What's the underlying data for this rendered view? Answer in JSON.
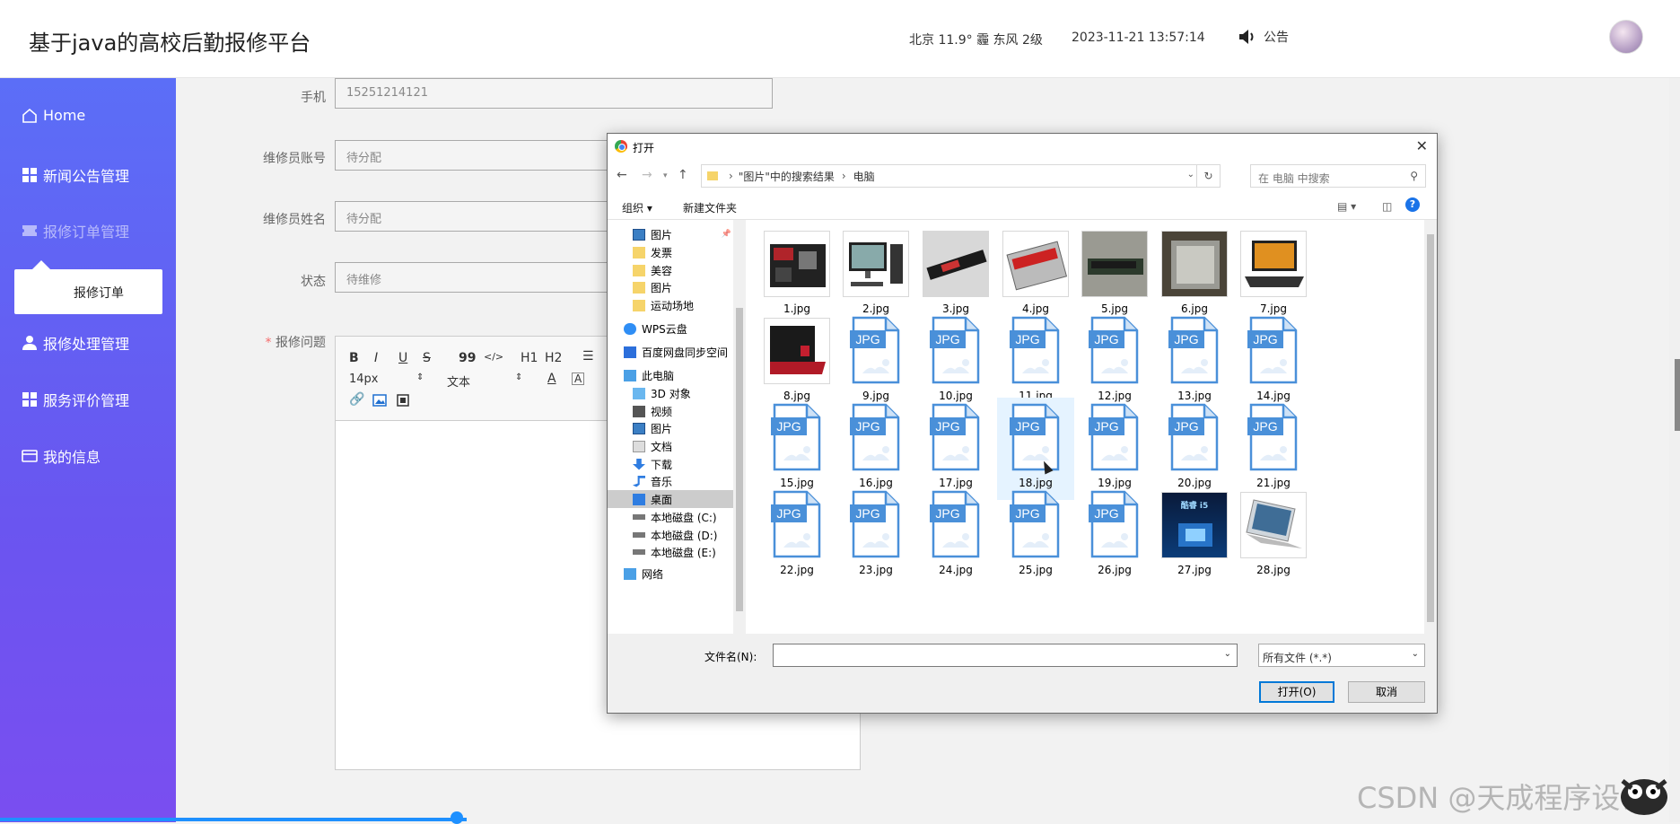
{
  "header": {
    "app_title": "基于java的高校后勤报修平台",
    "weather": "北京  11.9°  霾  东风  2级",
    "datetime": "2023-11-21 13:57:14",
    "notice_label": "公告"
  },
  "sidebar": {
    "items": [
      {
        "label": "Home",
        "icon": "home-icon"
      },
      {
        "label": "新闻公告管理",
        "icon": "grid-icon"
      },
      {
        "label": "报修订单管理",
        "icon": "ticket-icon"
      },
      {
        "label": "报修处理管理",
        "icon": "user-icon"
      },
      {
        "label": "服务评价管理",
        "icon": "grid-icon"
      },
      {
        "label": "我的信息",
        "icon": "card-icon"
      }
    ],
    "submenu_item": "报修订单"
  },
  "form": {
    "phone_label": "手机",
    "phone_value": "15251214121",
    "repairer_account_label": "维修员账号",
    "repairer_account_value": "待分配",
    "repairer_name_label": "维修员姓名",
    "repairer_name_value": "待分配",
    "status_label": "状态",
    "status_value": "待维修",
    "issue_label": "报修问题",
    "required_mark": "*"
  },
  "editor": {
    "bold": "B",
    "italic": "I",
    "underline": "U",
    "strike": "S",
    "quote": "99",
    "code": "</>",
    "h1": "H1",
    "h2": "H2",
    "font_size": "14px",
    "paragraph": "文本"
  },
  "dialog": {
    "title": "打开",
    "breadcrumb": [
      "\"图片\"中的搜索结果",
      "电脑"
    ],
    "search_placeholder": "在 电脑 中搜索",
    "toolbar": {
      "organize": "组织 ▾",
      "new_folder": "新建文件夹"
    },
    "tree": [
      {
        "label": "图片",
        "type": "pictures",
        "pinned": true
      },
      {
        "label": "发票",
        "type": "folder"
      },
      {
        "label": "美容",
        "type": "folder"
      },
      {
        "label": "图片",
        "type": "folder"
      },
      {
        "label": "运动场地",
        "type": "folder"
      },
      {
        "label": "WPS云盘",
        "type": "cloud"
      },
      {
        "label": "百度网盘同步空间",
        "type": "baidu"
      },
      {
        "label": "此电脑",
        "type": "pc"
      },
      {
        "label": "3D 对象",
        "type": "3d"
      },
      {
        "label": "视频",
        "type": "video"
      },
      {
        "label": "图片",
        "type": "pictures"
      },
      {
        "label": "文档",
        "type": "docs"
      },
      {
        "label": "下载",
        "type": "download"
      },
      {
        "label": "音乐",
        "type": "music"
      },
      {
        "label": "桌面",
        "type": "desktop",
        "selected": true
      },
      {
        "label": "本地磁盘 (C:)",
        "type": "disk"
      },
      {
        "label": "本地磁盘 (D:)",
        "type": "disk"
      },
      {
        "label": "本地磁盘 (E:)",
        "type": "disk"
      },
      {
        "label": "网络",
        "type": "network"
      }
    ],
    "files": [
      {
        "name": "1.jpg",
        "thumb": "motherboard"
      },
      {
        "name": "2.jpg",
        "thumb": "desktop-pc"
      },
      {
        "name": "3.jpg",
        "thumb": "ssd-m2"
      },
      {
        "name": "4.jpg",
        "thumb": "ssd"
      },
      {
        "name": "5.jpg",
        "thumb": "ram"
      },
      {
        "name": "6.jpg",
        "thumb": "cpu"
      },
      {
        "name": "7.jpg",
        "thumb": "laptop"
      },
      {
        "name": "8.jpg",
        "thumb": "laptop-red"
      },
      {
        "name": "9.jpg",
        "thumb": "jpg"
      },
      {
        "name": "10.jpg",
        "thumb": "jpg"
      },
      {
        "name": "11.jpg",
        "thumb": "jpg"
      },
      {
        "name": "12.jpg",
        "thumb": "jpg"
      },
      {
        "name": "13.jpg",
        "thumb": "jpg"
      },
      {
        "name": "14.jpg",
        "thumb": "jpg"
      },
      {
        "name": "15.jpg",
        "thumb": "jpg"
      },
      {
        "name": "16.jpg",
        "thumb": "jpg"
      },
      {
        "name": "17.jpg",
        "thumb": "jpg"
      },
      {
        "name": "18.jpg",
        "thumb": "jpg",
        "hover": true
      },
      {
        "name": "19.jpg",
        "thumb": "jpg"
      },
      {
        "name": "20.jpg",
        "thumb": "jpg"
      },
      {
        "name": "21.jpg",
        "thumb": "jpg"
      },
      {
        "name": "22.jpg",
        "thumb": "jpg"
      },
      {
        "name": "23.jpg",
        "thumb": "jpg"
      },
      {
        "name": "24.jpg",
        "thumb": "jpg"
      },
      {
        "name": "25.jpg",
        "thumb": "jpg"
      },
      {
        "name": "26.jpg",
        "thumb": "jpg"
      },
      {
        "name": "27.jpg",
        "thumb": "poster"
      },
      {
        "name": "28.jpg",
        "thumb": "laptop-silver"
      }
    ],
    "jpg_badge": "JPG",
    "poster_text": "酷睿 i5",
    "filename_label": "文件名(N):",
    "filename_value": "",
    "filter": "所有文件 (*.*)",
    "open_button": "打开(O)",
    "cancel_button": "取消"
  },
  "watermark": "CSDN @天成程序设计",
  "colors": {
    "accent": "#1e90ff",
    "sidebar_top": "#5b6ef7",
    "sidebar_bottom": "#7a4ef0",
    "jpg_blue": "#4a90d9"
  }
}
